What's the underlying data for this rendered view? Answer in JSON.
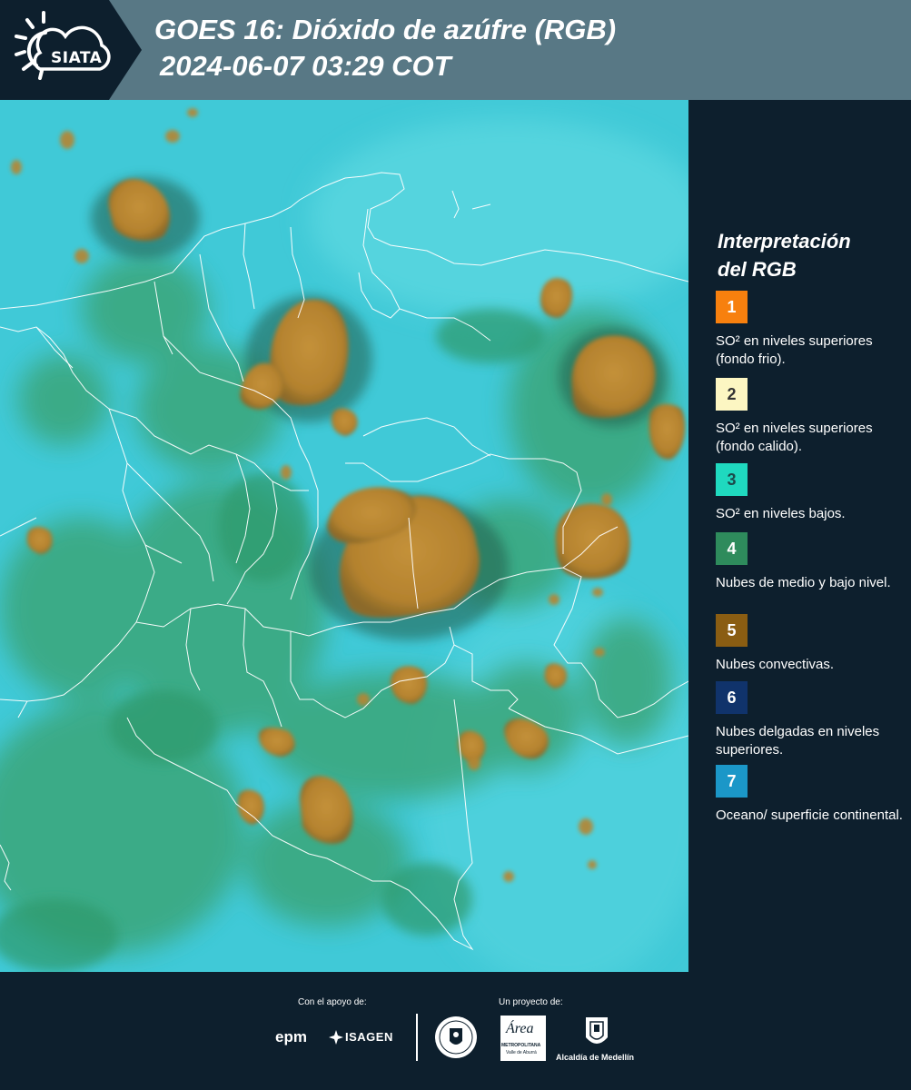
{
  "header": {
    "logo_text": "SIATA",
    "title": "GOES 16: Dióxido de azúfre (RGB)",
    "subtitle": "2024-06-07 03:29 COT"
  },
  "legend": {
    "title_line1": "Interpretación",
    "title_line2": "del RGB",
    "items": [
      {
        "number": "1",
        "color": "#f7800e",
        "desc": "SO² en niveles superiores (fondo frio)."
      },
      {
        "number": "2",
        "color": "#fcf6c2",
        "desc": "SO² en niveles superiores (fondo calido)."
      },
      {
        "number": "3",
        "color": "#1fd9bf",
        "desc": "SO² en niveles bajos."
      },
      {
        "number": "4",
        "color": "#2e8b5c",
        "desc": "Nubes de medio y bajo nivel."
      },
      {
        "number": "5",
        "color": "#8a5d12",
        "desc": "Nubes convectivas."
      },
      {
        "number": "6",
        "color": "#10336b",
        "desc": "Nubes delgadas en niveles superiores."
      },
      {
        "number": "7",
        "color": "#1b97c8",
        "desc": "Oceano/ superficie continental."
      }
    ]
  },
  "footer": {
    "sponsor_label": "Con el apoyo de:",
    "project_label": "Un proyecto de:",
    "epm": "epm",
    "isagen": "ISAGEN",
    "area_metro": "Área",
    "area_metro_sub": "METROPOLITANA",
    "area_metro_sub2": "Valle de Aburrá",
    "alcaldia": "Alcaldía de Medellín"
  }
}
